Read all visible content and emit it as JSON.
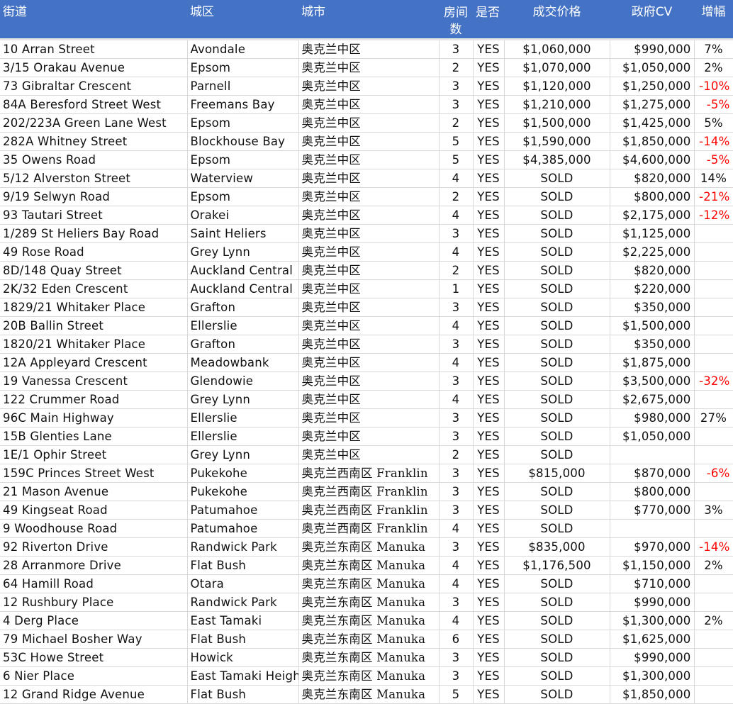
{
  "headers": [
    "街道",
    "城区",
    "城市",
    "房间数",
    "是否",
    "成交价格",
    "政府CV",
    "增幅"
  ],
  "rows": [
    [
      "10 Arran Street",
      "Avondale",
      "奥克兰中区",
      "3",
      "YES",
      "$1,060,000",
      "$990,000",
      "7%"
    ],
    [
      "3/15 Orakau Avenue",
      "Epsom",
      "奥克兰中区",
      "2",
      "YES",
      "$1,070,000",
      "$1,050,000",
      "2%"
    ],
    [
      "73 Gibraltar Crescent",
      "Parnell",
      "奥克兰中区",
      "3",
      "YES",
      "$1,120,000",
      "$1,250,000",
      "-10%"
    ],
    [
      "84A Beresford Street West",
      "Freemans Bay",
      "奥克兰中区",
      "3",
      "YES",
      "$1,210,000",
      "$1,275,000",
      "-5%"
    ],
    [
      "202/223A Green Lane West",
      "Epsom",
      "奥克兰中区",
      "2",
      "YES",
      "$1,500,000",
      "$1,425,000",
      "5%"
    ],
    [
      "282A Whitney Street",
      "Blockhouse Bay",
      "奥克兰中区",
      "5",
      "YES",
      "$1,590,000",
      "$1,850,000",
      "-14%"
    ],
    [
      "35 Owens Road",
      "Epsom",
      "奥克兰中区",
      "5",
      "YES",
      "$4,385,000",
      "$4,600,000",
      "-5%"
    ],
    [
      "5/12 Alverston Street",
      "Waterview",
      "奥克兰中区",
      "4",
      "YES",
      "SOLD",
      "$820,000",
      "14%"
    ],
    [
      "9/19 Selwyn Road",
      "Epsom",
      "奥克兰中区",
      "2",
      "YES",
      "SOLD",
      "$800,000",
      "-21%"
    ],
    [
      "93 Tautari Street",
      "Orakei",
      "奥克兰中区",
      "4",
      "YES",
      "SOLD",
      "$2,175,000",
      "-12%"
    ],
    [
      "1/289 St Heliers Bay Road",
      "Saint Heliers",
      "奥克兰中区",
      "3",
      "YES",
      "SOLD",
      "$1,125,000",
      ""
    ],
    [
      "49 Rose Road",
      "Grey Lynn",
      "奥克兰中区",
      "4",
      "YES",
      "SOLD",
      "$2,225,000",
      ""
    ],
    [
      "8D/148 Quay Street",
      "Auckland Central",
      "奥克兰中区",
      "2",
      "YES",
      "SOLD",
      "$820,000",
      ""
    ],
    [
      "2K/32 Eden Crescent",
      "Auckland Central",
      "奥克兰中区",
      "1",
      "YES",
      "SOLD",
      "$220,000",
      ""
    ],
    [
      "1829/21 Whitaker Place",
      "Grafton",
      "奥克兰中区",
      "3",
      "YES",
      "SOLD",
      "$350,000",
      ""
    ],
    [
      "20B Ballin Street",
      "Ellerslie",
      "奥克兰中区",
      "4",
      "YES",
      "SOLD",
      "$1,500,000",
      ""
    ],
    [
      "1820/21 Whitaker Place",
      "Grafton",
      "奥克兰中区",
      "3",
      "YES",
      "SOLD",
      "$350,000",
      ""
    ],
    [
      "12A Appleyard Crescent",
      "Meadowbank",
      "奥克兰中区",
      "4",
      "YES",
      "SOLD",
      "$1,875,000",
      ""
    ],
    [
      "19 Vanessa Crescent",
      "Glendowie",
      "奥克兰中区",
      "3",
      "YES",
      "SOLD",
      "$3,500,000",
      "-32%"
    ],
    [
      "122 Crummer Road",
      "Grey Lynn",
      "奥克兰中区",
      "4",
      "YES",
      "SOLD",
      "$2,675,000",
      ""
    ],
    [
      "96C Main Highway",
      "Ellerslie",
      "奥克兰中区",
      "3",
      "YES",
      "SOLD",
      "$980,000",
      "27%"
    ],
    [
      "15B Glenties Lane",
      "Ellerslie",
      "奥克兰中区",
      "3",
      "YES",
      "SOLD",
      "$1,050,000",
      ""
    ],
    [
      "1E/1 Ophir Street",
      "Grey Lynn",
      "奥克兰中区",
      "2",
      "YES",
      "SOLD",
      "",
      ""
    ],
    [
      "159C Princes Street West",
      "Pukekohe",
      "奥克兰西南区 Franklin",
      "3",
      "YES",
      "$815,000",
      "$870,000",
      "-6%"
    ],
    [
      "21 Mason Avenue",
      "Pukekohe",
      "奥克兰西南区 Franklin",
      "3",
      "YES",
      "SOLD",
      "$800,000",
      ""
    ],
    [
      "49 Kingseat Road",
      "Patumahoe",
      "奥克兰西南区 Franklin",
      "3",
      "YES",
      "SOLD",
      "$770,000",
      "3%"
    ],
    [
      "9 Woodhouse Road",
      "Patumahoe",
      "奥克兰西南区 Franklin",
      "4",
      "YES",
      "SOLD",
      "",
      ""
    ],
    [
      "92 Riverton Drive",
      "Randwick Park",
      "奥克兰东南区 Manuka",
      "3",
      "YES",
      "$835,000",
      "$970,000",
      "-14%"
    ],
    [
      "28 Arranmore Drive",
      "Flat Bush",
      "奥克兰东南区 Manuka",
      "4",
      "YES",
      "$1,176,500",
      "$1,150,000",
      "2%"
    ],
    [
      "64 Hamill Road",
      "Otara",
      "奥克兰东南区 Manuka",
      "4",
      "YES",
      "SOLD",
      "$710,000",
      ""
    ],
    [
      "12 Rushbury Place",
      "Randwick Park",
      "奥克兰东南区 Manuka",
      "3",
      "YES",
      "SOLD",
      "$990,000",
      ""
    ],
    [
      "4 Derg Place",
      "East Tamaki",
      "奥克兰东南区 Manuka",
      "4",
      "YES",
      "SOLD",
      "$1,300,000",
      "2%"
    ],
    [
      "79 Michael Bosher Way",
      "Flat Bush",
      "奥克兰东南区 Manuka",
      "6",
      "YES",
      "SOLD",
      "$1,625,000",
      ""
    ],
    [
      "53C Howe Street",
      "Howick",
      "奥克兰东南区 Manuka",
      "3",
      "YES",
      "SOLD",
      "$990,000",
      ""
    ],
    [
      "6 Nier Place",
      "East Tamaki Heigh",
      "奥克兰东南区 Manuka",
      "3",
      "YES",
      "SOLD",
      "$1,300,000",
      ""
    ],
    [
      "12 Grand Ridge Avenue",
      "Flat Bush",
      "奥克兰东南区 Manuka",
      "5",
      "YES",
      "SOLD",
      "$1,850,000",
      ""
    ]
  ],
  "colors": {
    "header_bg": "#4472c4",
    "header_text": "#ffffff",
    "negative": "#ff0000",
    "gridline": "#d9d9d9"
  }
}
